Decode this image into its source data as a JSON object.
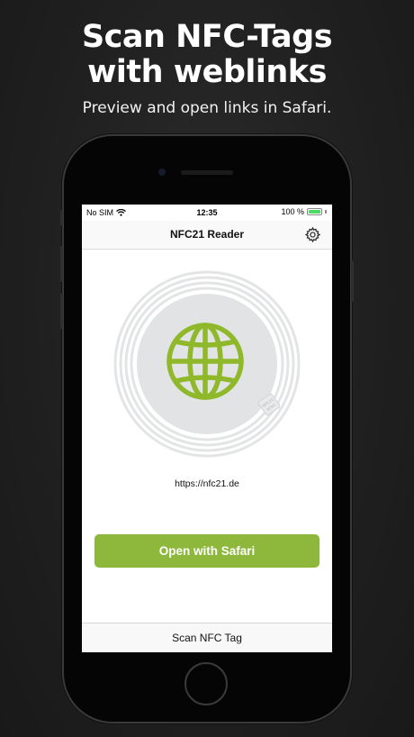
{
  "promo": {
    "headline_line1": "Scan NFC-Tags",
    "headline_line2": "with weblinks",
    "subline": "Preview and open links in Safari."
  },
  "status_bar": {
    "carrier": "No SIM",
    "time": "12:35",
    "battery_text": "100 %",
    "battery_level": 1.0
  },
  "nav": {
    "title": "NFC21 Reader",
    "settings_icon": "gear-icon"
  },
  "tag": {
    "icon": "globe-icon",
    "url": "https://nfc21.de",
    "chip_label": "NFC21",
    "chip_label_2": "NTAG"
  },
  "actions": {
    "open_label": "Open with Safari",
    "scan_label": "Scan NFC Tag"
  },
  "colors": {
    "accent": "#8db83b",
    "globe": "#8fb82a",
    "tag_disc": "#e2e3e4",
    "background": "#222222"
  }
}
